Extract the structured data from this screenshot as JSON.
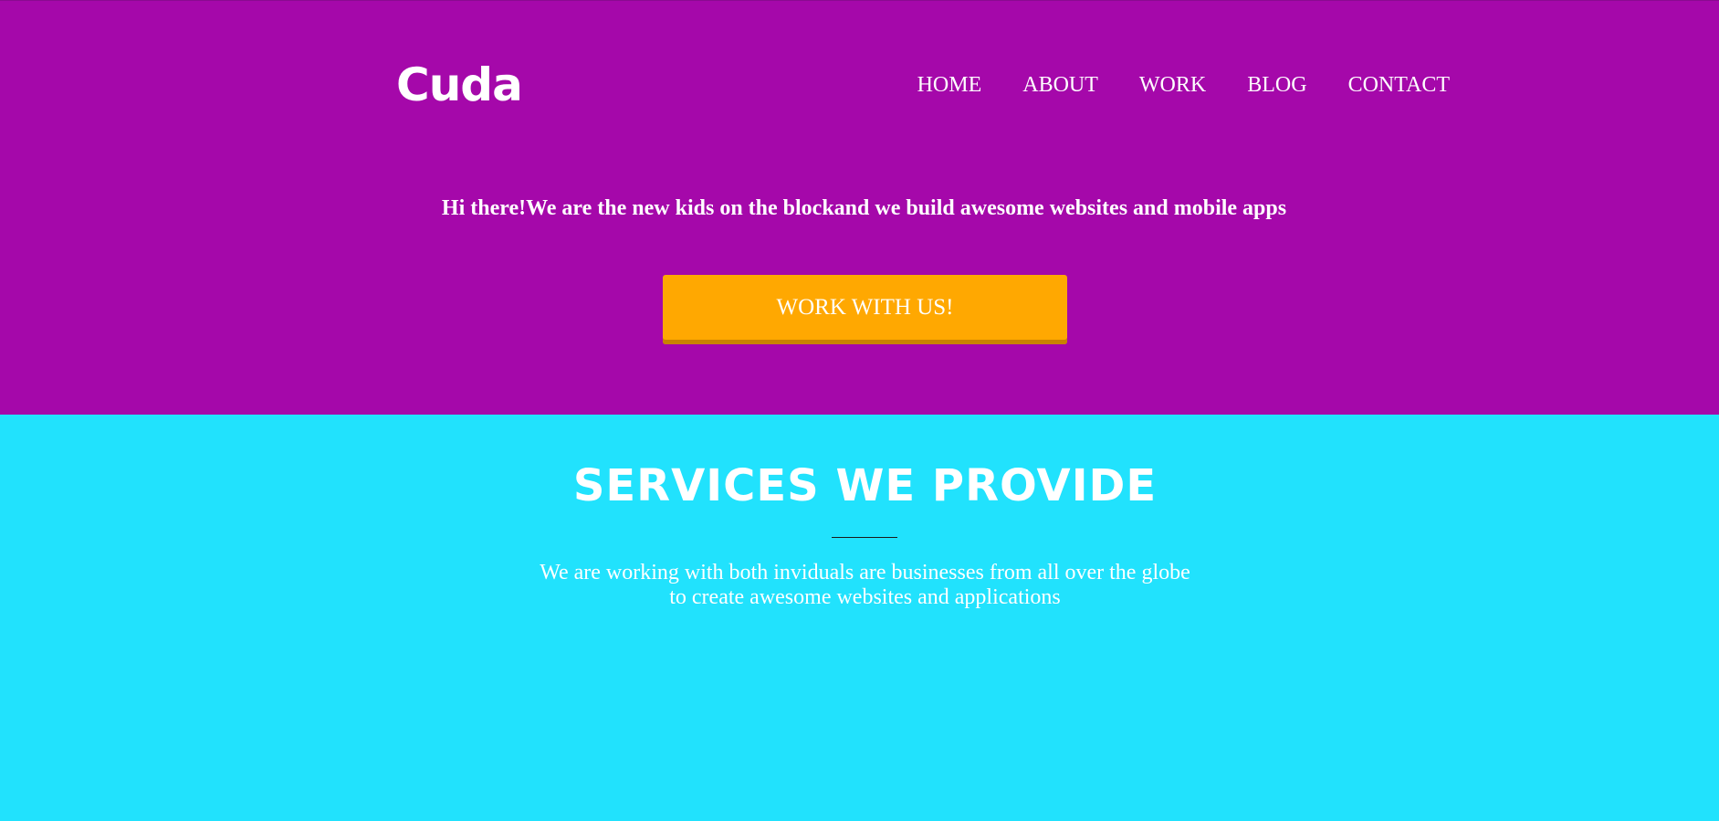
{
  "header": {
    "logo": "Cuda",
    "nav": [
      "HOME",
      "ABOUT",
      "WORK",
      "BLOG",
      "CONTACT"
    ]
  },
  "hero": {
    "tagline": "Hi there!We are the new kids on the blockand we build awesome websites and mobile apps",
    "cta_label": "WORK WITH US!"
  },
  "services": {
    "title": "SERVICES WE PROVIDE",
    "description_line1": "We are working with both inviduals are businesses from all over the globe",
    "description_line2": "to create awesome websites and applications"
  },
  "colors": {
    "hero_background": "#a508aa",
    "services_background": "#21e2fd",
    "cta_background": "#ffa801",
    "text": "#ffffff"
  }
}
